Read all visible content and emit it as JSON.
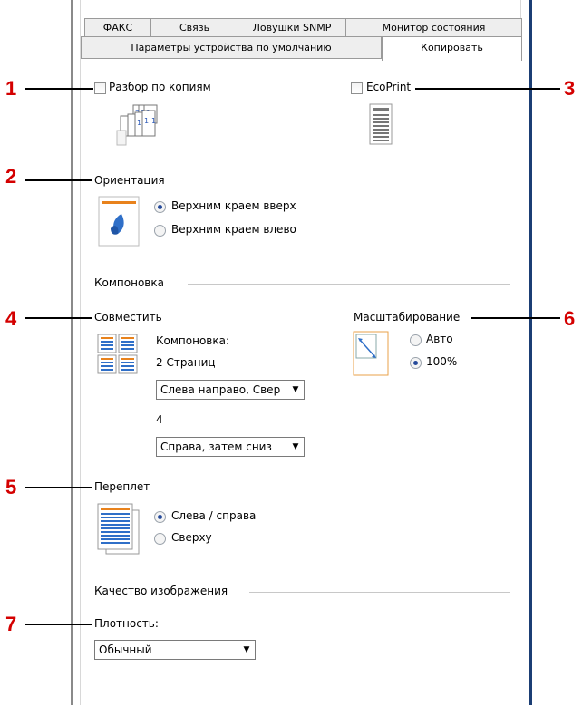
{
  "tabs_back": [
    "ФАКС",
    "Связь",
    "Ловушки SNMP",
    "Монитор состояния"
  ],
  "tab_front_left": "Параметры устройства по умолчанию",
  "tab_active": "Копировать",
  "callouts": [
    "1",
    "2",
    "3",
    "4",
    "5",
    "6",
    "7"
  ],
  "collate": {
    "label": "Разбор по копиям",
    "checked": false,
    "icon": "collate-pages-icon"
  },
  "ecoprint": {
    "label": "EcoPrint",
    "checked": false,
    "icon": "ecoprint-page-icon"
  },
  "orientation": {
    "title": "Ориентация",
    "icon": "orientation-portrait-icon",
    "options": [
      "Верхним краем вверх",
      "Верхним краем влево"
    ],
    "selected": 0
  },
  "layout_section": "Компоновка",
  "combine": {
    "title": "Совместить",
    "icon": "nup-layout-icon",
    "layout_label": "Компоновка:",
    "two_pages_label": "2 Страниц",
    "two_pages_value": "Слева направо, Свер",
    "four_label": "4",
    "four_value": "Справа, затем сниз"
  },
  "scaling": {
    "title": "Масштабирование",
    "icon": "scaling-icon",
    "options": [
      "Авто",
      "100%"
    ],
    "selected": 1
  },
  "binding": {
    "title": "Переплет",
    "icon": "binding-icon",
    "options": [
      "Слева / справа",
      "Сверху"
    ],
    "selected": 0
  },
  "quality_section": "Качество изображения",
  "density": {
    "label": "Плотность:",
    "value": "Обычный"
  },
  "colors": {
    "accent_radio": "#254a9a",
    "callout": "#d40000",
    "border_blue": "#1b3e74"
  }
}
